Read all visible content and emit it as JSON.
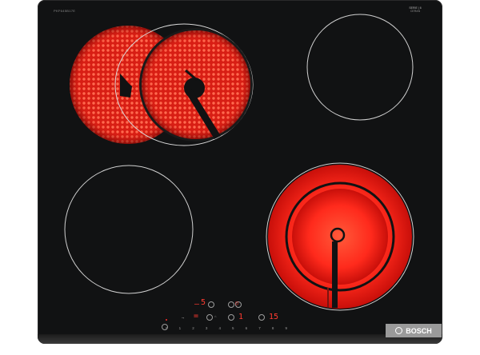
{
  "product": {
    "model_code": "PKF645B17E",
    "brand": "BOSCH",
    "series": "SERIE | 6",
    "series_sub": "CERAN"
  },
  "controls": {
    "front_left_level": "5",
    "rear_left_level": "1",
    "timer_value": "15",
    "slider_scale": [
      "0",
      "1",
      "2",
      "3",
      "4",
      "5",
      "6",
      "7",
      "8",
      "9"
    ]
  },
  "zones": {
    "dual_zone_rear_left": "heating",
    "rear_right": "off",
    "front_left": "off",
    "dual_zone_front_right": "heating"
  },
  "colors": {
    "glass": "#111213",
    "heating_red": "#ff2a1c",
    "zone_outline": "#d0d0d0",
    "brand_plate": "#9a9a9a"
  }
}
